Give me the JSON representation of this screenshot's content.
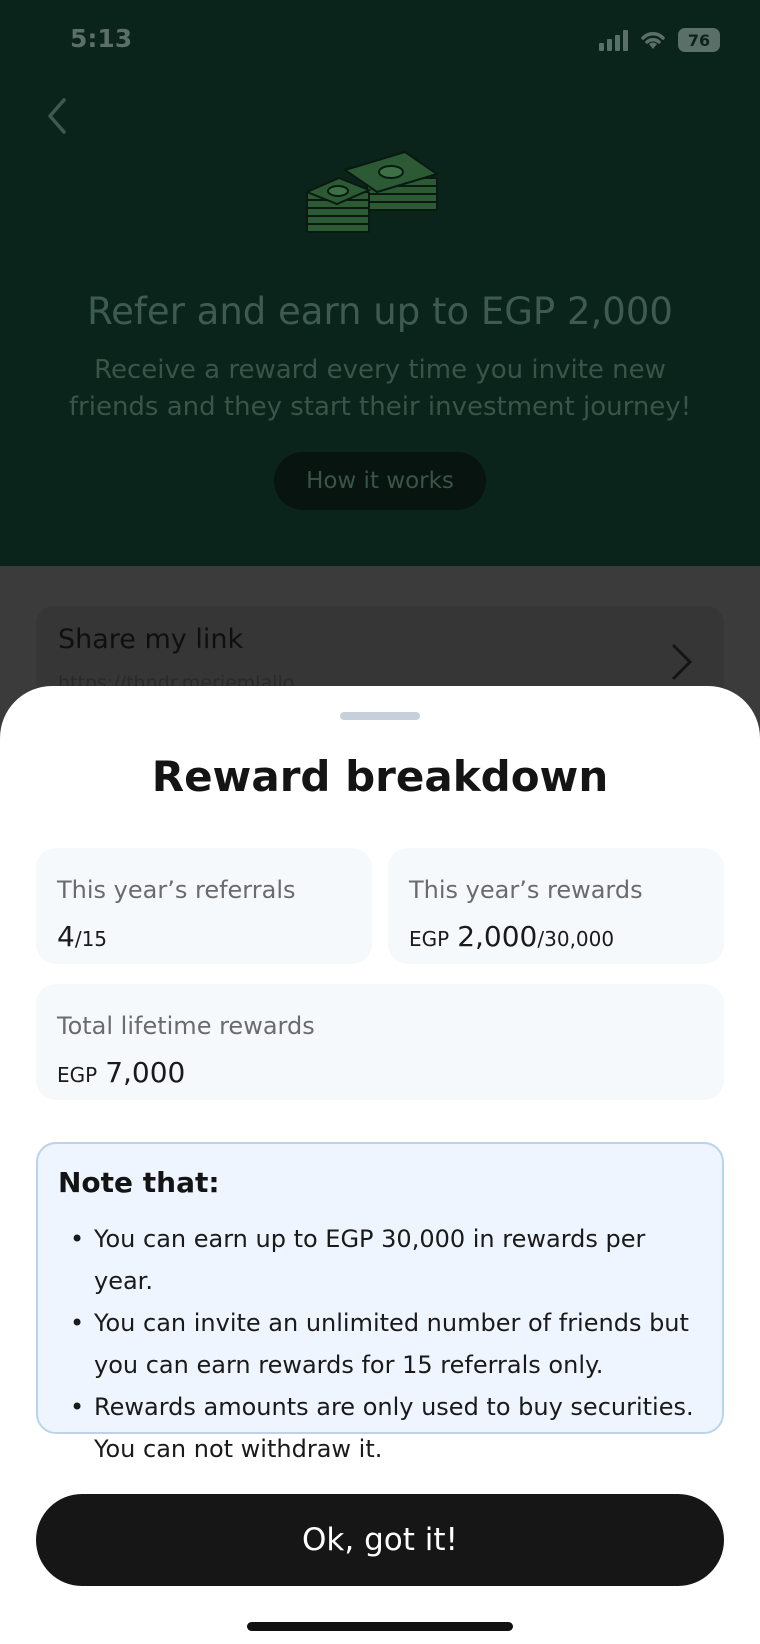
{
  "status_bar": {
    "time": "5:13",
    "battery": "76"
  },
  "hero": {
    "title": "Refer and earn up to EGP 2,000",
    "subtitle": "Receive a reward every time you invite new friends and they start their investment journey!",
    "how_it_works_label": "How it works"
  },
  "share": {
    "title": "Share my link",
    "url": "https://thndr.meriemlallo"
  },
  "sheet": {
    "title": "Reward breakdown",
    "referrals": {
      "label": "This year’s referrals",
      "value": "4",
      "limit": "/15"
    },
    "rewards": {
      "label": "This year’s rewards",
      "currency": "EGP",
      "value": "2,000",
      "limit": "/30,000"
    },
    "lifetime": {
      "label": "Total lifetime rewards",
      "currency": "EGP",
      "value": "7,000"
    },
    "note": {
      "title": "Note that:",
      "items": [
        "You can earn up to EGP 30,000 in rewards per year.",
        "You can invite an unlimited number of friends but you can earn rewards for 15 referrals only.",
        "Rewards amounts are only used to buy securities. You can not withdraw it."
      ]
    },
    "ok_label": "Ok, got it!"
  },
  "colors": {
    "overlay_top": "#0a241b",
    "sheet_bg": "#ffffff",
    "note_bg": "#eef5fe",
    "note_border": "#b9d3ef",
    "button_bg": "#161616"
  }
}
